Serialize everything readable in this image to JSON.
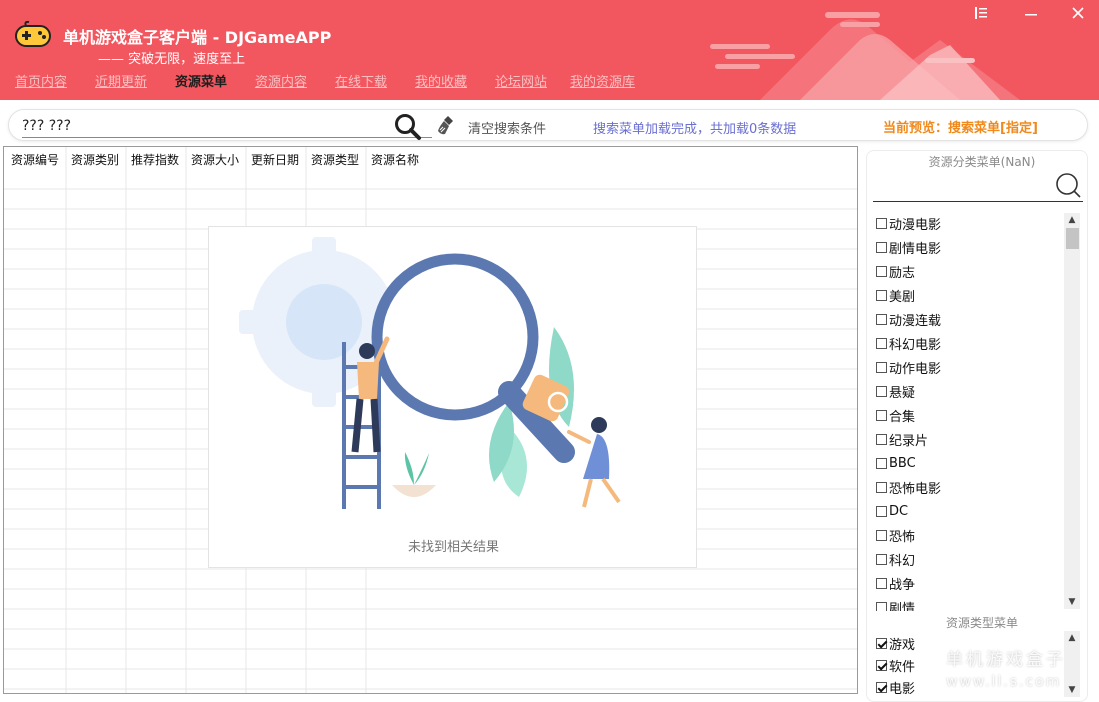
{
  "app": {
    "title": "单机游戏盒子客户端 - DJGameAPP",
    "slogan": "—— 突破无限，速度至上"
  },
  "window_controls": [
    {
      "name": "menu-icon",
      "glyph": "⁝☰"
    },
    {
      "name": "minimize-icon",
      "glyph": "—"
    },
    {
      "name": "close-icon",
      "glyph": "✕"
    }
  ],
  "nav": {
    "items": [
      "首页内容",
      "近期更新",
      "资源菜单",
      "资源内容",
      "在线下载",
      "我的收藏",
      "论坛网站",
      "我的资源库"
    ],
    "active": "资源菜单"
  },
  "search": {
    "value": "??? ???",
    "clear_label": "清空搜索条件",
    "status": "搜索菜单加载完成，共加载0条数据",
    "preview": "当前预览：搜索菜单[指定]"
  },
  "table": {
    "columns": [
      "资源编号",
      "资源类别",
      "推荐指数",
      "资源大小",
      "更新日期",
      "资源类型",
      "资源名称"
    ],
    "rows": []
  },
  "empty_state": {
    "message": "未找到相关结果"
  },
  "categories": {
    "title": "资源分类菜单(NaN)",
    "search_value": "",
    "items": [
      "动漫电影",
      "剧情电影",
      "励志",
      "美剧",
      "动漫连载",
      "科幻电影",
      "动作电影",
      "悬疑",
      "合集",
      "纪录片",
      "BBC",
      "恐怖电影",
      "DC",
      "恐怖",
      "科幻",
      "战争",
      "剧情"
    ]
  },
  "types": {
    "title": "资源类型菜单",
    "items": [
      {
        "label": "游戏",
        "checked": true
      },
      {
        "label": "软件",
        "checked": true
      },
      {
        "label": "电影",
        "checked": true
      }
    ]
  },
  "watermark": {
    "main": "单机游戏盒子",
    "sub": "www.ll.s.com"
  },
  "colors": {
    "header_bg": "#f2575f",
    "status_blue": "#6a6fd0",
    "preview_orange": "#f08a1c"
  }
}
